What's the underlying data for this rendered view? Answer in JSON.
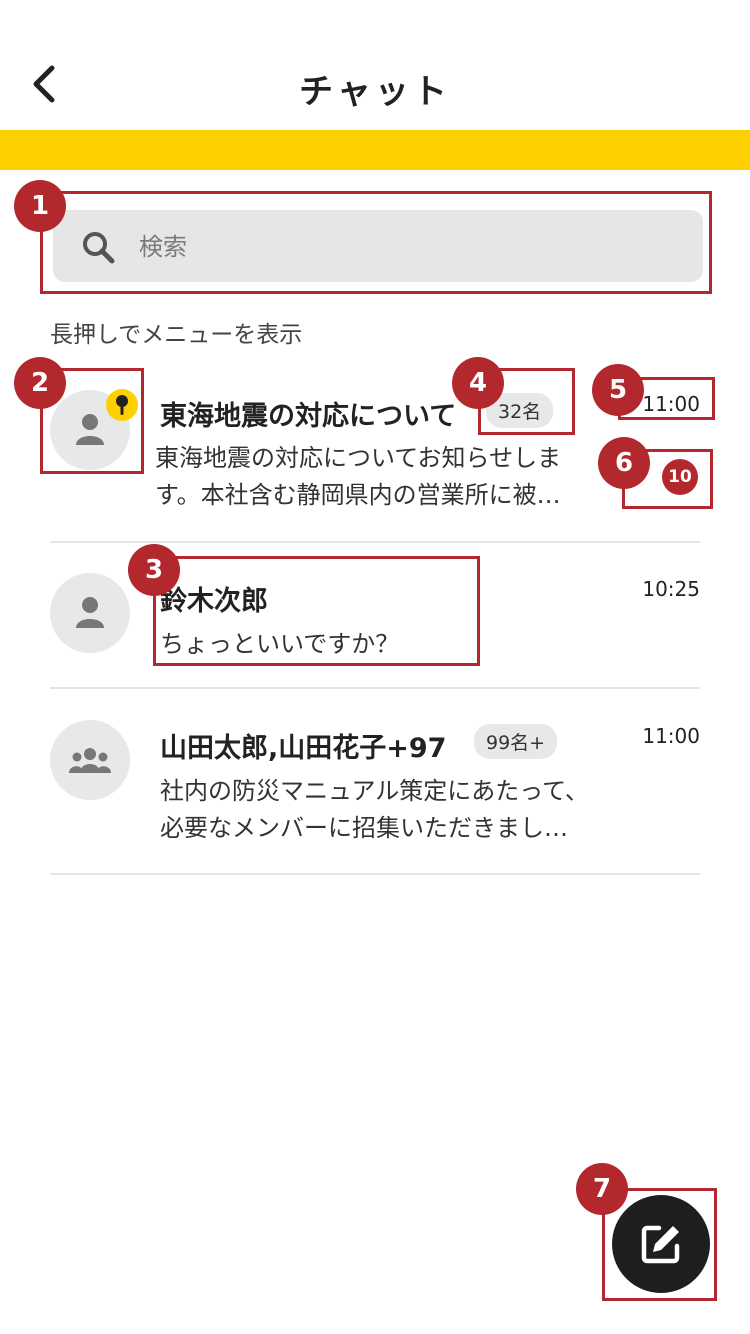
{
  "header": {
    "title": "チャット",
    "back_icon": "chevron-left-icon"
  },
  "accent_colors": {
    "bar": "#ffd000",
    "annotation": "#b3282d"
  },
  "search": {
    "placeholder": "検索",
    "value": ""
  },
  "hint": "長押しでメニューを表示",
  "chats": [
    {
      "name": "東海地震の対応について",
      "member_count": "32名",
      "time": "11:00",
      "preview": [
        "東海地震の対応についてお知らせしま",
        "す。本社含む静岡県内の営業所に被…"
      ],
      "unread": "10",
      "pinned": true,
      "avatar": "person-icon"
    },
    {
      "name": "鈴木次郎",
      "time": "10:25",
      "preview": [
        "ちょっといいですか？"
      ],
      "avatar": "person-icon"
    },
    {
      "name": "山田太郎,山田花子+97",
      "member_count": "99名+",
      "time": "11:00",
      "preview": [
        "社内の防災マニュアル策定にあたって、",
        "必要なメンバーに招集いただきまし…"
      ],
      "avatar": "group-icon"
    }
  ],
  "annotations": [
    "1",
    "2",
    "3",
    "4",
    "5",
    "6",
    "7"
  ],
  "fab": {
    "icon": "compose-icon"
  }
}
